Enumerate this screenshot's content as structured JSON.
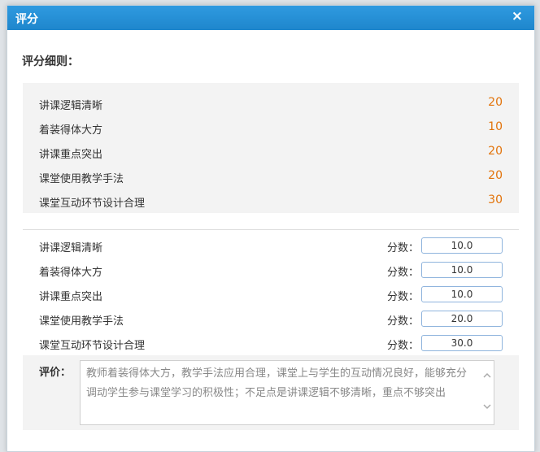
{
  "modal": {
    "title": "评分",
    "close_glyph": "×"
  },
  "rules": {
    "heading": "评分细则：",
    "items": [
      {
        "name": "讲课逻辑清晰",
        "points": "20"
      },
      {
        "name": "着装得体大方",
        "points": "10"
      },
      {
        "name": "讲课重点突出",
        "points": "20"
      },
      {
        "name": "课堂使用教学手法",
        "points": "20"
      },
      {
        "name": "课堂互动环节设计合理",
        "points": "30"
      }
    ]
  },
  "scores": {
    "field_label": "分数：",
    "items": [
      {
        "name": "讲课逻辑清晰",
        "value": "10.0"
      },
      {
        "name": "着装得体大方",
        "value": "10.0"
      },
      {
        "name": "讲课重点突出",
        "value": "10.0"
      },
      {
        "name": "课堂使用教学手法",
        "value": "20.0"
      },
      {
        "name": "课堂互动环节设计合理",
        "value": "30.0"
      }
    ]
  },
  "comment": {
    "label": "评价：",
    "text": "教师着装得体大方，教学手法应用合理，课堂上与学生的互动情况良好，能够充分调动学生参与课堂学习的积极性；不足点是讲课逻辑不够清晰，重点不够突出"
  },
  "colors": {
    "header": "#1e86cc",
    "points": "#e2730a",
    "input_border": "#8fb4dd"
  },
  "icons": {
    "close": "close-icon",
    "scroll_up": "chevron-up-icon",
    "scroll_down": "chevron-down-icon"
  }
}
